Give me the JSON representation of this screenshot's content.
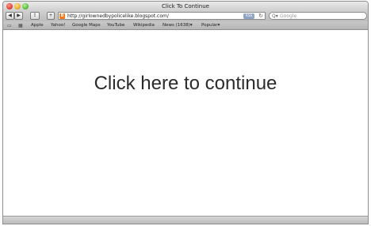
{
  "window": {
    "title": "Click To Continue"
  },
  "toolbar": {
    "back_label": "◀",
    "forward_label": "▶",
    "share_label": "⇪",
    "add_label": "+",
    "url": "http://girlownedbypolicelike.blogspot.com/",
    "rss_label": "RSS",
    "reload_label": "↻",
    "search_placeholder": "Google",
    "search_icon_label": "Q▾"
  },
  "bookmarks": {
    "items": [
      "Apple",
      "Yahoo!",
      "Google Maps",
      "YouTube",
      "Wikipedia",
      "News (1638)▾",
      "Popular▾"
    ]
  },
  "content": {
    "headline": "Click here to continue"
  }
}
